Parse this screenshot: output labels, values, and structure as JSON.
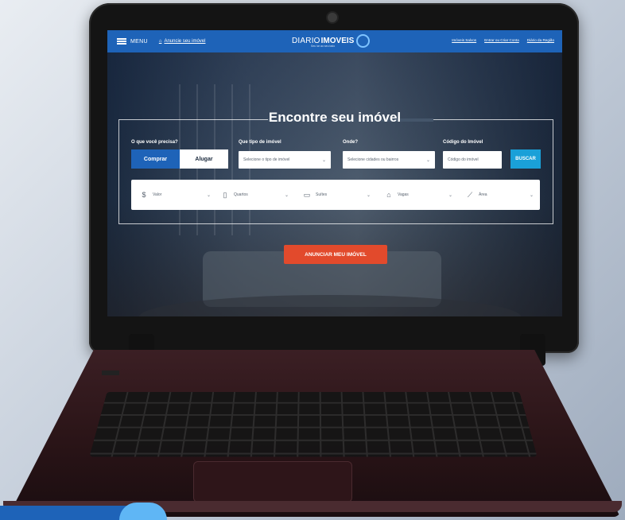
{
  "header": {
    "menu_label": "MENU",
    "announce_link": "Anuncie seu imóvel",
    "logo_part1": "DIARIO",
    "logo_part2": "IMOVEIS",
    "logo_sub": "Seu lar ao seu lado",
    "links": [
      "Imóveis Salvos",
      "Entrar ou Criar Conta",
      "Diário da Região"
    ]
  },
  "hero": {
    "title": "Encontre seu imóvel",
    "need_label": "O que você precisa?",
    "buy_label": "Comprar",
    "rent_label": "Alugar",
    "type_label": "Que tipo de imóvel",
    "type_placeholder": "Selecione o tipo de imóvel",
    "where_label": "Onde?",
    "where_placeholder": "Selecione cidades ou bairros",
    "code_label": "Código do Imóvel",
    "code_placeholder": "Código do imóvel",
    "search_label": "BUSCAR"
  },
  "filters": [
    {
      "label": "Valor",
      "icon": "currency-icon"
    },
    {
      "label": "Quartos",
      "icon": "bed-icon"
    },
    {
      "label": "Suítes",
      "icon": "bathtub-icon"
    },
    {
      "label": "Vagas",
      "icon": "garage-icon"
    },
    {
      "label": "Área",
      "icon": "ruler-icon"
    }
  ],
  "cta_label": "ANUNCIAR MEU IMÓVEL",
  "colors": {
    "primary": "#1e63b8",
    "accent": "#e24a2c",
    "search": "#1aa0d8"
  }
}
